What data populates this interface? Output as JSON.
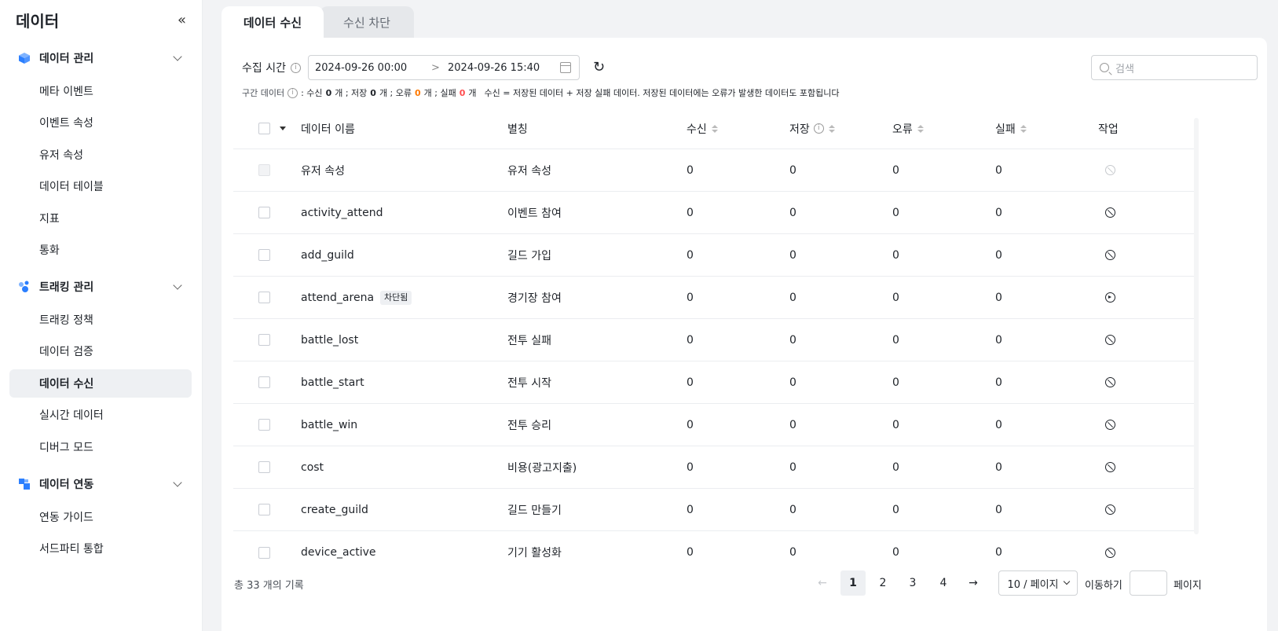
{
  "sidebar": {
    "title": "데이터",
    "collapse_icon": "«",
    "groups": [
      {
        "label": "데이터 관리",
        "icon": "cube-icon",
        "items": [
          "메타 이벤트",
          "이벤트 속성",
          "유저 속성",
          "데이터 테이블",
          "지표",
          "통화"
        ]
      },
      {
        "label": "트래킹 관리",
        "icon": "tracking-dots-icon",
        "items": [
          "트래킹 정책",
          "데이터 검증",
          "데이터 수신",
          "실시간 데이터",
          "디버그 모드"
        ]
      },
      {
        "label": "데이터 연동",
        "icon": "integration-blocks-icon",
        "items": [
          "연동 가이드",
          "서드파티 통합"
        ]
      }
    ],
    "active_item": "데이터 수신"
  },
  "tabs": [
    "데이터 수신",
    "수신 차단"
  ],
  "filter": {
    "label": "수집 시간",
    "start": "2024-09-26 00:00",
    "separator": ">",
    "end": "2024-09-26 15:40",
    "search_placeholder": "검색"
  },
  "summary": {
    "label": "구간 데이터",
    "received_label": ": 수신",
    "received": "0",
    "saved_label": "개 ; 저장",
    "saved": "0",
    "error_label": "개 ; 오류",
    "error": "0",
    "failed_label": "개 ; 실패",
    "failed": "0",
    "end_label": "개",
    "note": "수신 = 저장된 데이터 + 저장 실패 데이터. 저장된 데이터에는 오류가 발생한 데이터도 포함됩니다"
  },
  "table": {
    "columns": [
      "데이터 이름",
      "별칭",
      "수신",
      "저장",
      "오류",
      "실패",
      "작업"
    ],
    "rows": [
      {
        "name": "유저 속성",
        "alias": "유저 속성",
        "received": "0",
        "saved": "0",
        "error": "0",
        "failed": "0",
        "action": "block-icon-disabled",
        "checkbox_disabled": true,
        "tag": ""
      },
      {
        "name": "activity_attend",
        "alias": "이벤트 참여",
        "received": "0",
        "saved": "0",
        "error": "0",
        "failed": "0",
        "action": "block-icon",
        "checkbox_disabled": false,
        "tag": ""
      },
      {
        "name": "add_guild",
        "alias": "길드 가입",
        "received": "0",
        "saved": "0",
        "error": "0",
        "failed": "0",
        "action": "block-icon",
        "checkbox_disabled": false,
        "tag": ""
      },
      {
        "name": "attend_arena",
        "alias": "경기장 참여",
        "received": "0",
        "saved": "0",
        "error": "0",
        "failed": "0",
        "action": "play-icon",
        "checkbox_disabled": false,
        "tag": "차단됨"
      },
      {
        "name": "battle_lost",
        "alias": "전투 실패",
        "received": "0",
        "saved": "0",
        "error": "0",
        "failed": "0",
        "action": "block-icon",
        "checkbox_disabled": false,
        "tag": ""
      },
      {
        "name": "battle_start",
        "alias": "전투 시작",
        "received": "0",
        "saved": "0",
        "error": "0",
        "failed": "0",
        "action": "block-icon",
        "checkbox_disabled": false,
        "tag": ""
      },
      {
        "name": "battle_win",
        "alias": "전투 승리",
        "received": "0",
        "saved": "0",
        "error": "0",
        "failed": "0",
        "action": "block-icon",
        "checkbox_disabled": false,
        "tag": ""
      },
      {
        "name": "cost",
        "alias": "비용(광고지출)",
        "received": "0",
        "saved": "0",
        "error": "0",
        "failed": "0",
        "action": "block-icon",
        "checkbox_disabled": false,
        "tag": ""
      },
      {
        "name": "create_guild",
        "alias": "길드 만들기",
        "received": "0",
        "saved": "0",
        "error": "0",
        "failed": "0",
        "action": "block-icon",
        "checkbox_disabled": false,
        "tag": ""
      },
      {
        "name": "device_active",
        "alias": "기기 활성화",
        "received": "0",
        "saved": "0",
        "error": "0",
        "failed": "0",
        "action": "block-icon",
        "checkbox_disabled": false,
        "tag": ""
      }
    ]
  },
  "footer": {
    "total": "총 33 개의 기록",
    "prev": "←",
    "pages": [
      "1",
      "2",
      "3",
      "4"
    ],
    "current_page": "1",
    "next": "→",
    "page_size": "10 / 페이지",
    "goto_label": "이동하기",
    "goto_suffix": "페이지"
  },
  "colors": {
    "accent_orange": "#ff7a00",
    "accent_red": "#ff4d4f",
    "brand_blue": "#2b7fff"
  }
}
